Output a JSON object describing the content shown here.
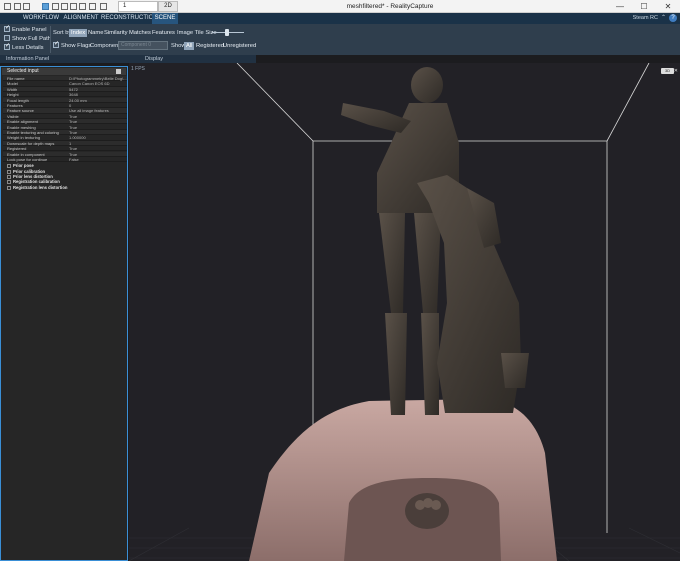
{
  "titlebar": {
    "view_tab_1": "1",
    "view_tab_2": "2D",
    "title": "meshfiltered* - RealityCapture",
    "minimize": "—",
    "maximize": "☐",
    "close": "✕"
  },
  "menu": {
    "items": [
      "WORKFLOW",
      "ALIGNMENT",
      "RECONSTRUCTION",
      "SCENE"
    ],
    "active": "SCENE",
    "account": "Steam RC",
    "help": "?"
  },
  "ribbon": {
    "enable_panel": "Enable Panel",
    "show_full_path": "Show Full Path",
    "less_details": "Less Details",
    "sort_by": "Sort by",
    "sort_options": [
      "Index",
      "Name",
      "Similarity",
      "Matches",
      "Features"
    ],
    "image_tile_size": "Image Tile Size",
    "show_flags": "Show Flags",
    "component": "Component",
    "component_value": "Component 0",
    "show": "Show",
    "show_options": [
      "All",
      "Registered",
      "Unregistered"
    ],
    "group_information": "Information Panel",
    "group_display": "Display"
  },
  "panel": {
    "title": "Selected input",
    "rows": [
      {
        "k": "File name",
        "v": "D:\\Photogrammetry\\Belle Dog\\..."
      },
      {
        "k": "Model",
        "v": "Canon Canon EOS 6D"
      },
      {
        "k": "Width",
        "v": "5472"
      },
      {
        "k": "Height",
        "v": "3648"
      },
      {
        "k": "Focal length",
        "v": "24.00 mm"
      },
      {
        "k": "Features",
        "v": "0"
      },
      {
        "k": "Feature source",
        "v": "Use all image features"
      },
      {
        "k": "Visible",
        "v": "True"
      },
      {
        "k": "Enable alignment",
        "v": "True"
      },
      {
        "k": "Enable meshing",
        "v": "True"
      },
      {
        "k": "Enable texturing and coloring",
        "v": "True"
      },
      {
        "k": "Weight in texturing",
        "v": "1.000000"
      },
      {
        "k": "Downscale for depth maps",
        "v": "1"
      },
      {
        "k": "Registered",
        "v": "True"
      },
      {
        "k": "Enable in component",
        "v": "True"
      },
      {
        "k": "Lock pose for continue",
        "v": "False"
      }
    ],
    "sections": [
      "Prior pose",
      "Prior calibration",
      "Prior lens distortion",
      "Registration calibration",
      "Registration lens distortion"
    ]
  },
  "viewport": {
    "fps": "1 FPS",
    "button": "3D",
    "close": "✕"
  }
}
